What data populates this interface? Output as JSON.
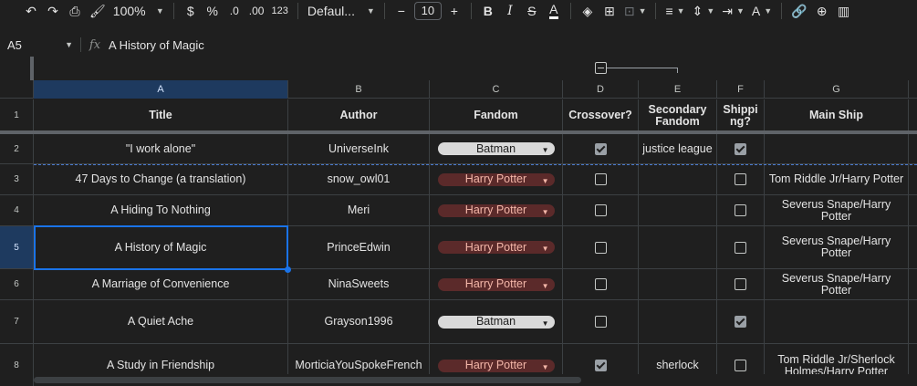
{
  "toolbar": {
    "zoom": "100%",
    "currency": "$",
    "percent": "%",
    "dec_decrease": ".0",
    "dec_increase": ".00",
    "number_format": "123",
    "font": "Defaul...",
    "font_size": "10",
    "bold": "B",
    "italic": "I",
    "strike": "S",
    "text_color": "A"
  },
  "formula_bar": {
    "name_box": "A5",
    "fx": "fx",
    "value": "A History of Magic"
  },
  "columns": [
    {
      "letter": "A"
    },
    {
      "letter": "B"
    },
    {
      "letter": "C"
    },
    {
      "letter": "D"
    },
    {
      "letter": "E"
    },
    {
      "letter": "F"
    },
    {
      "letter": "G"
    }
  ],
  "header_row": {
    "num": "1",
    "title": "Title",
    "author": "Author",
    "fandom": "Fandom",
    "crossover": "Crossover?",
    "secondary": "Secondary Fandom",
    "shipping": "Shipping?",
    "main_ship": "Main Ship"
  },
  "rows": [
    {
      "num": "2",
      "title": "\"I work alone\"",
      "author": "UniverseInk",
      "fandom": "Batman",
      "crossover": true,
      "secondary": "justice league",
      "shipping": true,
      "ship": ""
    },
    {
      "num": "3",
      "title": "47 Days to Change (a translation)",
      "author": "snow_owl01",
      "fandom": "Harry Potter",
      "crossover": false,
      "secondary": "",
      "shipping": false,
      "ship": "Tom Riddle Jr/Harry Potter"
    },
    {
      "num": "4",
      "title": "A Hiding To Nothing",
      "author": "Meri",
      "fandom": "Harry Potter",
      "crossover": false,
      "secondary": "",
      "shipping": false,
      "ship": "Severus Snape/Harry Potter"
    },
    {
      "num": "5",
      "title": "A History of Magic",
      "author": "PrinceEdwin",
      "fandom": "Harry Potter",
      "crossover": false,
      "secondary": "",
      "shipping": false,
      "ship": "Severus Snape/Harry Potter"
    },
    {
      "num": "6",
      "title": "A Marriage of Convenience",
      "author": "NinaSweets",
      "fandom": "Harry Potter",
      "crossover": false,
      "secondary": "",
      "shipping": false,
      "ship": "Severus Snape/Harry Potter"
    },
    {
      "num": "7",
      "title": "A Quiet Ache",
      "author": "Grayson1996",
      "fandom": "Batman",
      "crossover": false,
      "secondary": "",
      "shipping": true,
      "ship": ""
    },
    {
      "num": "8",
      "title": "A Study in Friendship",
      "author": "MorticiaYouSpokeFrench",
      "fandom": "Harry Potter",
      "crossover": true,
      "secondary": "sherlock",
      "shipping": false,
      "ship": "Tom Riddle Jr/Sherlock Holmes/Harry Potter"
    }
  ],
  "colors": {
    "background": "#1f1f1f",
    "selection": "#1a73e8",
    "batman_chip": "#d9d9d9",
    "hp_chip": "#5b2a2a",
    "hp_chip_text": "#f3b6a8"
  }
}
